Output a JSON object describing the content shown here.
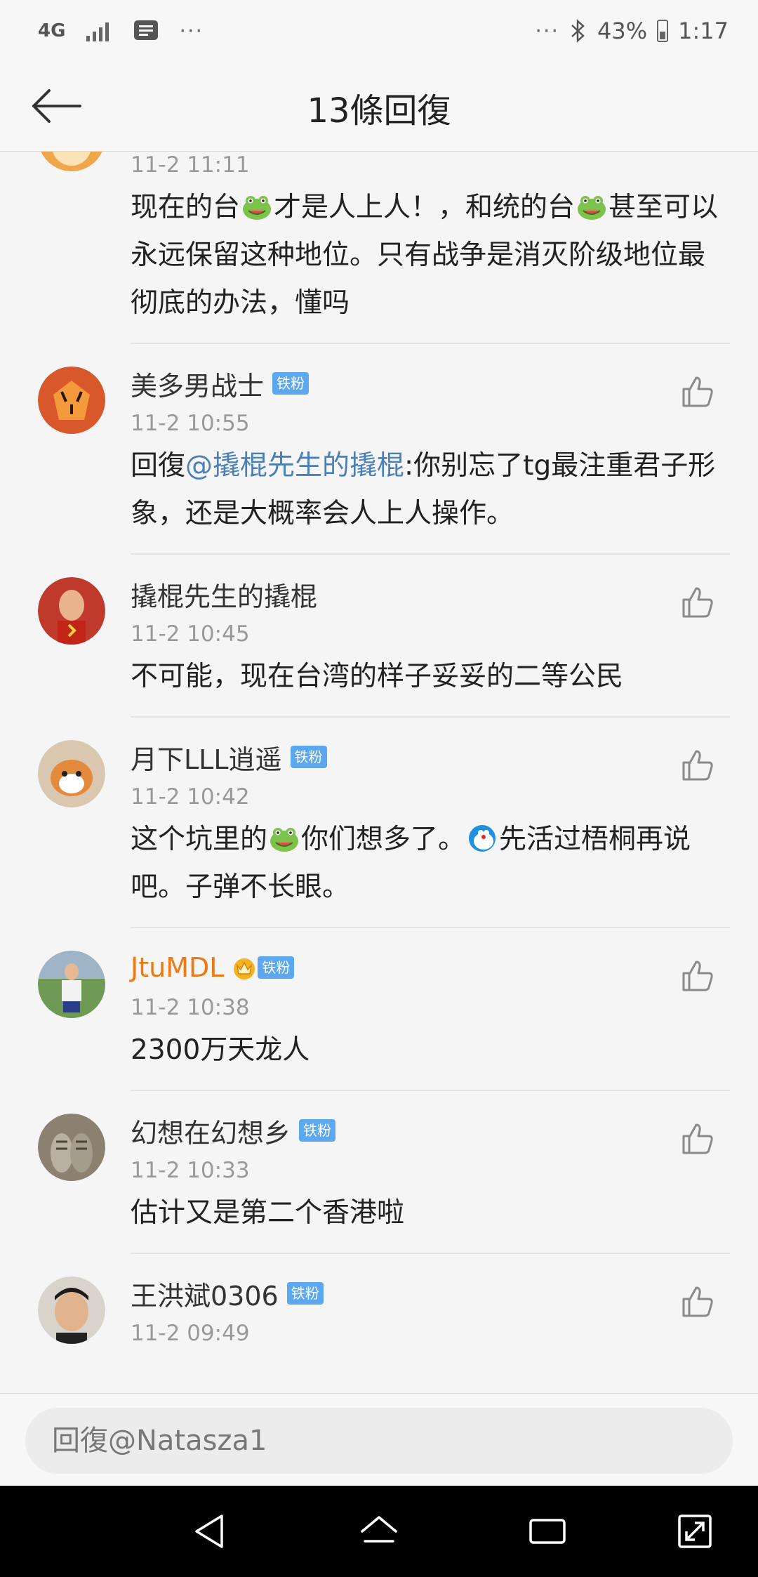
{
  "status_bar": {
    "network": "4G",
    "overflow": "···",
    "right_overflow": "···",
    "battery": "43%",
    "time": "1:17"
  },
  "header": {
    "title": "13條回復"
  },
  "comments": [
    {
      "name": "",
      "time": "11-2 11:11",
      "text_parts": [
        "现在的台",
        "才是人上人！，和统的台",
        "甚至可以永远保留这种地位。只有战争是消灭阶级地位最彻底的办法，懂吗"
      ]
    },
    {
      "name": "美多男战士",
      "badge": "铁粉",
      "time": "11-2 10:55",
      "reply_prefix": "回復",
      "mention": "@撬棍先生的撬棍",
      "text": ":你别忘了tg最注重君子形象，还是大概率会人上人操作。"
    },
    {
      "name": "撬棍先生的撬棍",
      "time": "11-2 10:45",
      "text": "不可能，现在台湾的样子妥妥的二等公民"
    },
    {
      "name": "月下LLL逍遥",
      "badge": "铁粉",
      "time": "11-2 10:42",
      "text_parts": [
        "这个坑里的",
        "你们想多了。",
        "先活过梧桐再说吧。子弹不长眼。"
      ]
    },
    {
      "name": "JtuMDL",
      "badge": "铁粉",
      "time": "11-2 10:38",
      "text": "2300万天龙人"
    },
    {
      "name": "幻想在幻想乡",
      "badge": "铁粉",
      "time": "11-2 10:33",
      "text": "估计又是第二个香港啦"
    },
    {
      "name": "王洪斌0306",
      "badge": "铁粉",
      "time": "11-2 09:49",
      "text": ""
    }
  ],
  "reply_box": {
    "placeholder": "回復@Natasza1"
  },
  "colors": {
    "mention": "#4a7fb8",
    "badge": "#5ba7f0",
    "vip_name": "#ef7a12"
  }
}
